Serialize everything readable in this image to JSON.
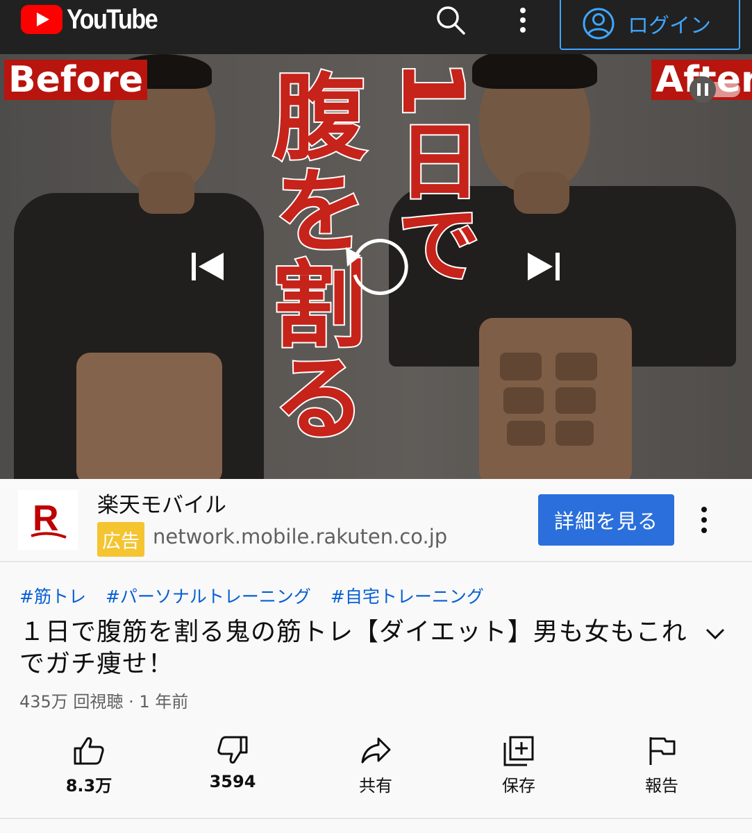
{
  "header": {
    "brand": "YouTube",
    "login_label": "ログイン"
  },
  "thumbnail": {
    "before_label": "Before",
    "after_label": "After",
    "title_col1": "腹を割る",
    "title_col2": "1日で"
  },
  "ad": {
    "advertiser": "楽天モバイル",
    "badge": "広告",
    "url": "network.mobile.rakuten.co.jp",
    "cta": "詳細を見る",
    "brand_color": "#bf0000"
  },
  "video": {
    "hashtags": [
      "#筋トレ",
      "#パーソナルトレーニング",
      "#自宅トレーニング"
    ],
    "title": "１日で腹筋を割る鬼の筋トレ【ダイエット】男も女もこれでガチ痩せ！",
    "meta": "435万 回視聴 · 1 年前"
  },
  "actions": {
    "like": "8.3万",
    "dislike": "3594",
    "share": "共有",
    "save": "保存",
    "report": "報告"
  },
  "colors": {
    "header_bg": "#212121",
    "link": "#065fd4",
    "cta": "#2a6fdb",
    "ad_badge": "#f4c431"
  }
}
